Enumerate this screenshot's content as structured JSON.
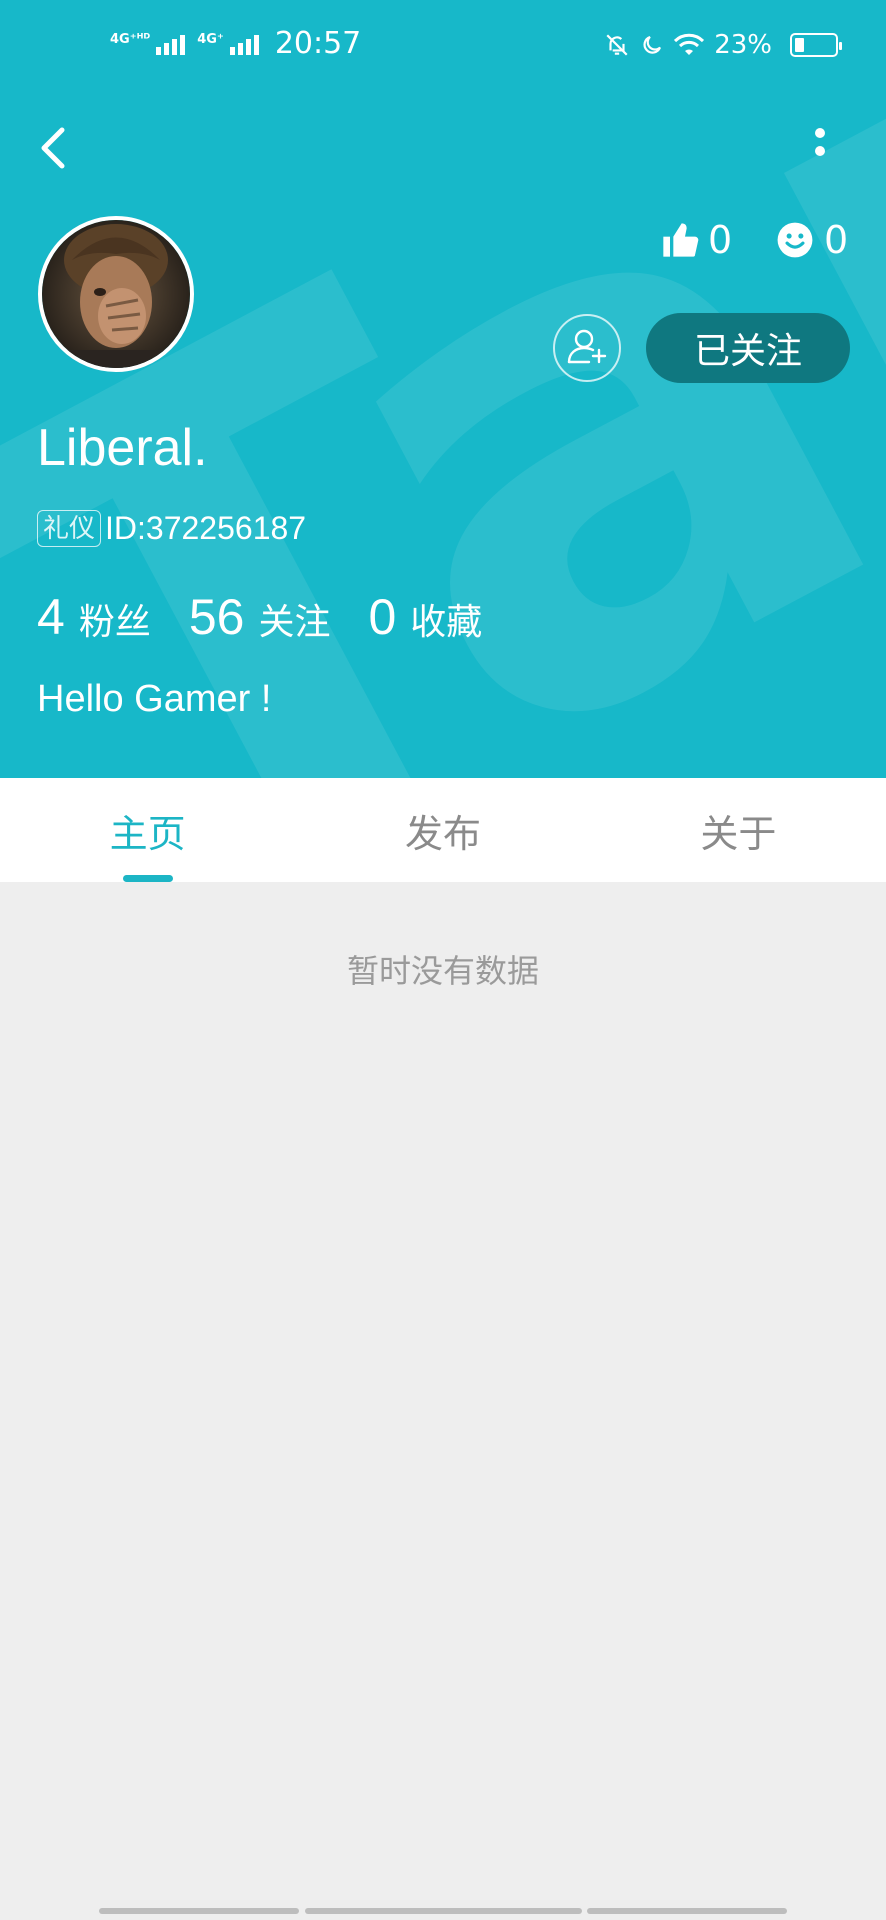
{
  "status_bar": {
    "signal1_label": "4G⁺ᴴᴰ",
    "signal2_label": "4G⁺",
    "time": "20:57",
    "battery_percent": "23%"
  },
  "header": {
    "background_color": "#17b8c9",
    "watermark_text": "Tap"
  },
  "profile": {
    "username": "Liberal.",
    "badge": "礼仪",
    "user_id": "ID:372256187",
    "likes_count": "0",
    "mood_count": "0",
    "follow_status": "已关注",
    "bio": "Hello Gamer !",
    "stats": [
      {
        "value": "4",
        "label": "粉丝"
      },
      {
        "value": "56",
        "label": "关注"
      },
      {
        "value": "0",
        "label": "收藏"
      }
    ]
  },
  "tabs": [
    {
      "label": "主页",
      "active": true
    },
    {
      "label": "发布",
      "active": false
    },
    {
      "label": "关于",
      "active": false
    }
  ],
  "content": {
    "empty_message": "暂时没有数据"
  },
  "colors": {
    "accent": "#1cb5c5",
    "follow_button": "#0f7880",
    "content_background": "#eeeeee"
  }
}
